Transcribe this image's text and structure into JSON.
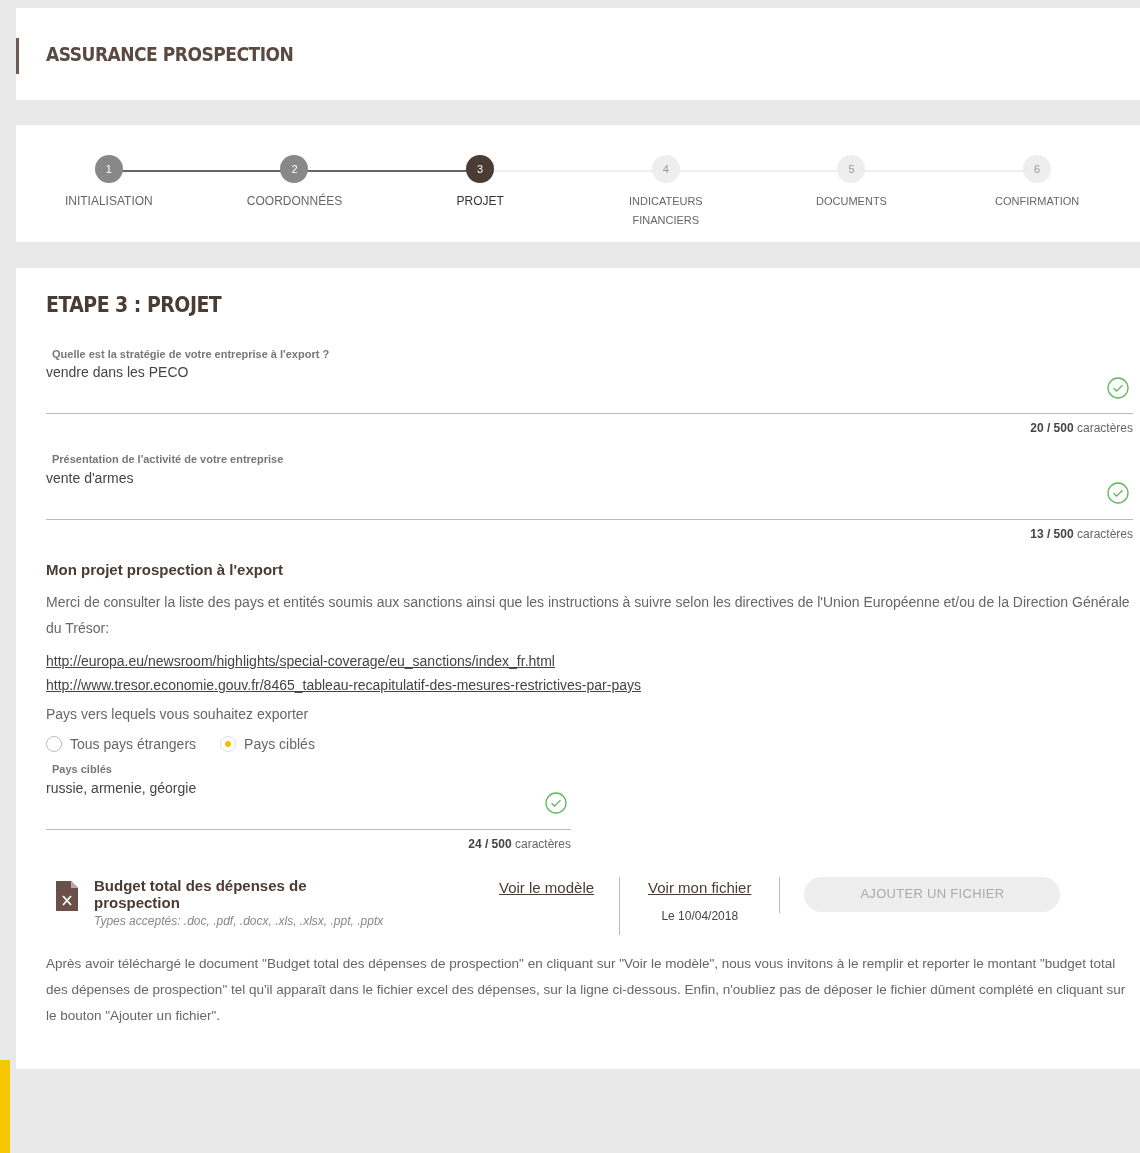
{
  "header": {
    "title": "ASSURANCE PROSPECTION"
  },
  "steps": [
    {
      "number": "1",
      "label": "INITIALISATION",
      "completed": true,
      "selected": false
    },
    {
      "number": "2",
      "label": "COORDONNÉES",
      "completed": true,
      "selected": false
    },
    {
      "number": "3",
      "label": "PROJET",
      "completed": false,
      "selected": true
    },
    {
      "number": "4",
      "label": "INDICATEURS FINANCIERS",
      "completed": false,
      "selected": false
    },
    {
      "number": "5",
      "label": "DOCUMENTS",
      "completed": false,
      "selected": false
    },
    {
      "number": "6",
      "label": "CONFIRMATION",
      "completed": false,
      "selected": false
    }
  ],
  "section": {
    "title": "ETAPE 3 : PROJET"
  },
  "fields": [
    {
      "label": "Quelle est la stratégie de votre entreprise à l'export ?",
      "value": "vendre dans les PECO",
      "valid": true,
      "counter": "**20 / 500** caractères"
    },
    {
      "label": "Présentation de l'activité de votre entreprise",
      "value": "vente d'armes",
      "valid": true,
      "counter": "**13 / 500** caractères"
    }
  ],
  "project": {
    "title": "Mon projet prospection à l'export",
    "intro": "Merci de consulter la liste des pays et entités soumis aux sanctions ainsi que les instructions à suivre selon les directives de l'Union Européenne et/ou de la Direction Générale du Trésor:",
    "links": [
      "http://europa.eu/newsroom/highlights/special-coverage/eu_sanctions/index_fr.html",
      "http://www.tresor.economie.gouv.fr/8465_tableau-recapitulatif-des-mesures-restrictives-par-pays"
    ],
    "question": "Pays vers lequels vous souhaitez exporter",
    "options": [
      {
        "label": "Tous pays étrangers",
        "selected": false
      },
      {
        "label": "Pays ciblés",
        "selected": true
      }
    ],
    "countries": {
      "label": "Pays ciblés",
      "value": "russie, armenie, géorgie",
      "valid": true,
      "counter": "**24 / 500** caractères"
    }
  },
  "file": {
    "title": "Budget total des dépenses de prospection",
    "types": "Types acceptés: .doc, .pdf, .docx, .xls, .xlsx, .ppt, .pptx",
    "model_link": "Voir le modèle",
    "my_file_link": "Voir mon fichier",
    "date": "Le 10/04/2018",
    "button": "AJOUTER UN FICHIER",
    "button_disabled": true
  },
  "note": "Après avoir téléchargé le document \"Budget total des dépenses de prospection\" en cliquant sur \"Voir le modèle\", nous vous invitons à le remplir et reporter le montant \"budget total des dépenses de prospection\" tel qu'il apparaît dans le fichier excel des dépenses, sur la ligne ci-dessous. Enfin, n'oubliez pas de déposer le fichier dûment complété en cliquant sur le bouton \"Ajouter un fichier\"."
}
